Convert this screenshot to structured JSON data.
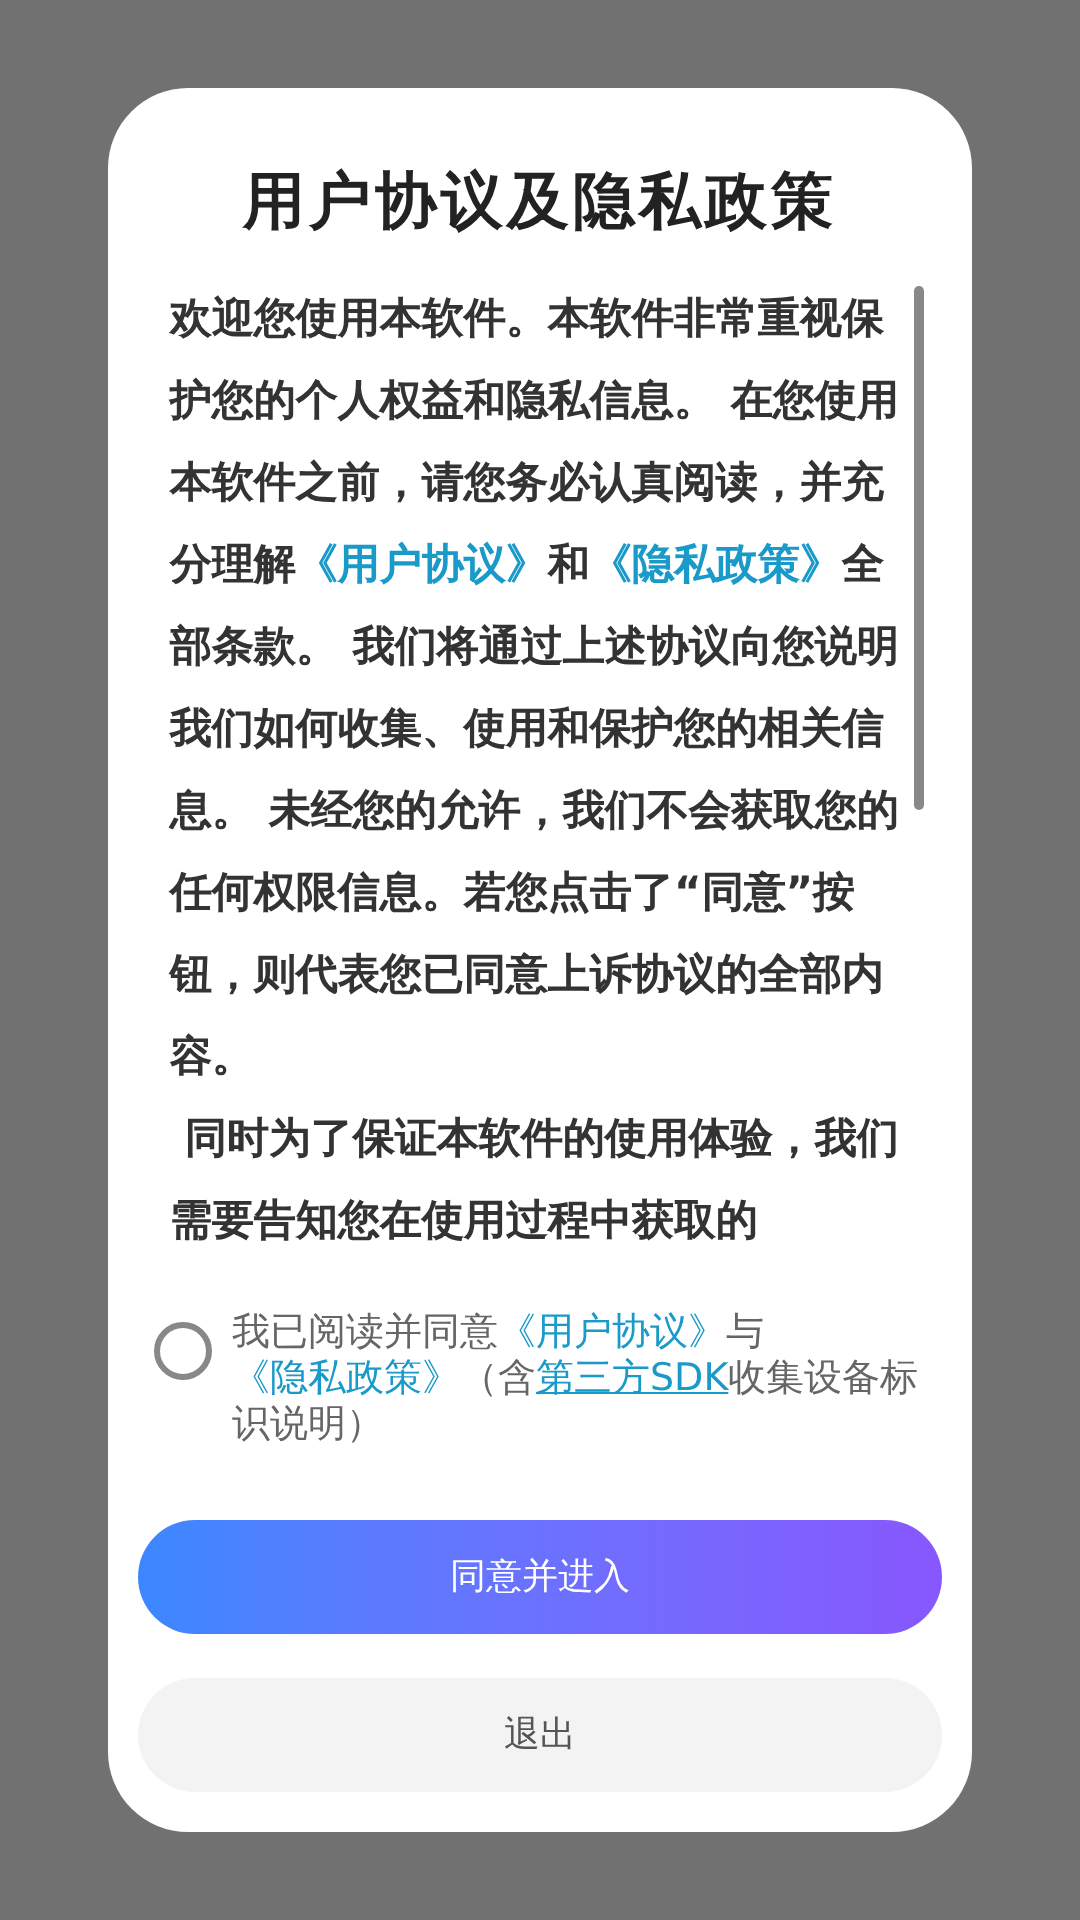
{
  "dialog": {
    "title": "用户协议及隐私政策",
    "paragraphs": [
      [
        {
          "kind": "text",
          "text": "欢迎您使用本软件。本软件非常重视保护您的个人权益和隐私信息。 在您使用本软件之前，请您务必认真阅读，并充分理解"
        },
        {
          "kind": "link",
          "text": "《用户协议》"
        },
        {
          "kind": "text",
          "text": "和"
        },
        {
          "kind": "link",
          "text": "《隐私政策》"
        },
        {
          "kind": "text",
          "text": "全部条款。 我们将通过上述协议向您说明我们如何收集、使用和保护您的相关信息。 未经您的允许，我们不会获取您的任何权限信息。若您点击了“同意”按钮，则代表您已同意上诉协议的全部内容。"
        }
      ],
      [
        {
          "kind": "text",
          "text": " 同时为了保证本软件的使用体验，我们需要告知您在使用过程中获取的"
        }
      ]
    ],
    "consent": {
      "checked": false,
      "segments": [
        {
          "kind": "text",
          "text": "我已阅读并同意"
        },
        {
          "kind": "link",
          "text": "《用户协议》"
        },
        {
          "kind": "text",
          "text": "与"
        },
        {
          "kind": "link",
          "text": "《隐私政策》"
        },
        {
          "kind": "text",
          "text": "（含"
        },
        {
          "kind": "underline",
          "text": "第三方SDK"
        },
        {
          "kind": "text",
          "text": "收集设备标识说明）"
        }
      ]
    },
    "buttons": [
      {
        "kind": "primary",
        "label": "同意并进入"
      },
      {
        "kind": "secondary",
        "label": "退出"
      }
    ]
  }
}
